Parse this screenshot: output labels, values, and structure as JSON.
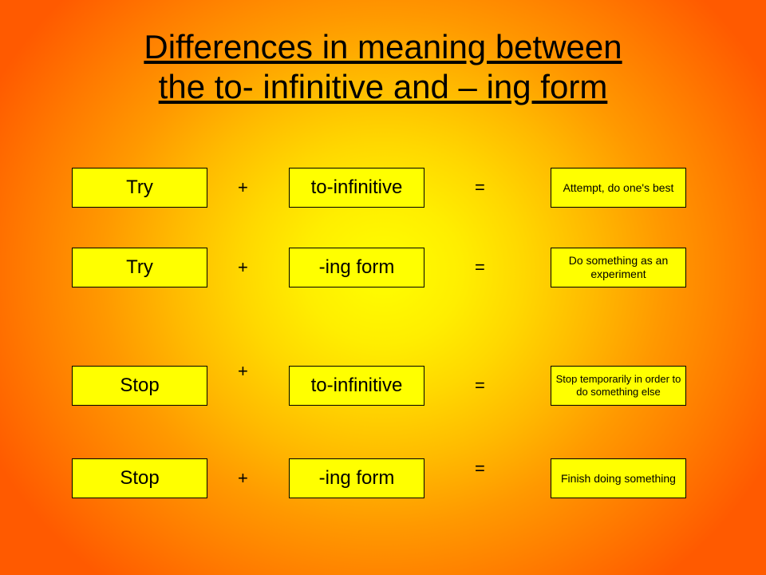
{
  "title_line1": "Differences in meaning between",
  "title_line2": "the to- infinitive and – ing form",
  "rows": [
    {
      "verb": "Try",
      "form": "to-infinitive",
      "meaning": "Attempt, do one's best"
    },
    {
      "verb": "Try",
      "form": "-ing form",
      "meaning": "Do something as an experiment"
    },
    {
      "verb": "Stop",
      "form": "to-infinitive",
      "meaning": "Stop temporarily in order to do something else"
    },
    {
      "verb": "Stop",
      "form": "-ing form",
      "meaning": "Finish doing something"
    }
  ],
  "sym": {
    "plus": "+",
    "eq": "="
  }
}
